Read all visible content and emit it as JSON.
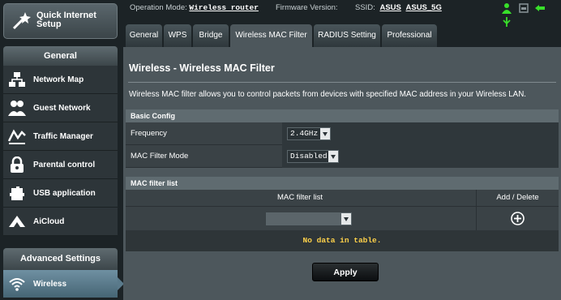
{
  "sidebar": {
    "quick_setup": "Quick Internet Setup",
    "general_heading": "General",
    "items": [
      {
        "label": "Network Map",
        "icon": "network-map-icon"
      },
      {
        "label": "Guest Network",
        "icon": "guest-network-icon"
      },
      {
        "label": "Traffic Manager",
        "icon": "traffic-manager-icon"
      },
      {
        "label": "Parental control",
        "icon": "parental-control-icon"
      },
      {
        "label": "USB application",
        "icon": "usb-application-icon"
      },
      {
        "label": "AiCloud",
        "icon": "aicloud-icon"
      }
    ],
    "advanced_heading": "Advanced Settings",
    "active_item": {
      "label": "Wireless",
      "icon": "wireless-icon"
    }
  },
  "topbar": {
    "operation_mode_label": "Operation Mode:",
    "operation_mode_value": "Wireless router",
    "firmware_label": "Firmware Version:",
    "ssid_label": "SSID:",
    "ssid_1": "ASUS",
    "ssid_2": "ASUS_5G"
  },
  "tabs": [
    {
      "label": "General"
    },
    {
      "label": "WPS"
    },
    {
      "label": "Bridge"
    },
    {
      "label": "Wireless MAC Filter"
    },
    {
      "label": "RADIUS Setting"
    },
    {
      "label": "Professional"
    }
  ],
  "main": {
    "title": "Wireless - Wireless MAC Filter",
    "description": "Wireless MAC filter allows you to control packets from devices with specified MAC address in your Wireless LAN.",
    "basic_config_heading": "Basic Config",
    "frequency_label": "Frequency",
    "frequency_value": "2.4GHz",
    "mode_label": "MAC Filter Mode",
    "mode_value": "Disabled",
    "list_heading": "MAC filter list",
    "list_col_header": "MAC filter list",
    "add_delete_header": "Add / Delete",
    "empty_message": "No data in table.",
    "apply_label": "Apply"
  },
  "colors": {
    "accent_yellow": "#ffd24a",
    "active_tab": "#4d575c",
    "sidebar_active": "#5a7a8b"
  }
}
